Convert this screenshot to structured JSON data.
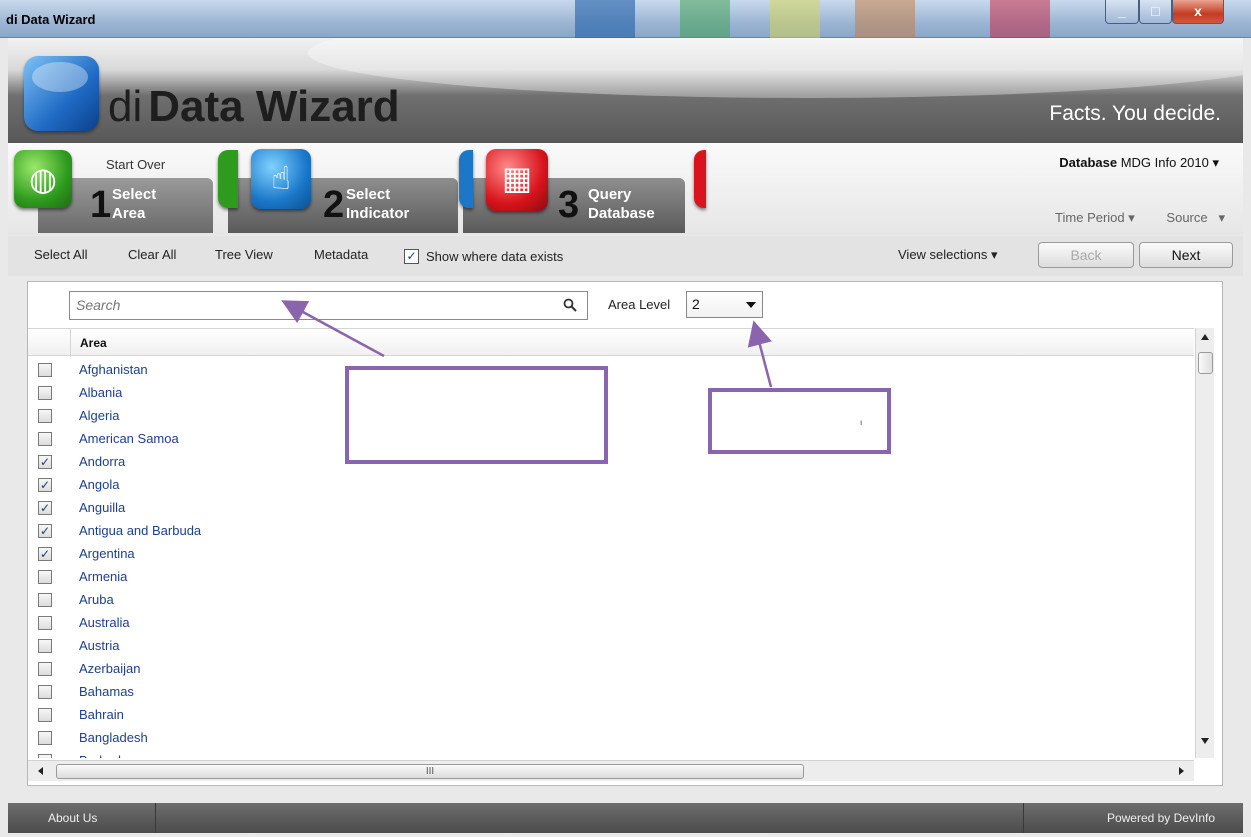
{
  "window": {
    "title": "di Data Wizard",
    "close_glyph": "x"
  },
  "banner": {
    "title_di": "di",
    "title_main": "Data Wizard",
    "tagline": "Facts. You decide."
  },
  "steps": {
    "start_over": "Start Over",
    "items": [
      {
        "number": "1",
        "line1": "Select",
        "line2": "Area"
      },
      {
        "number": "2",
        "line1": "Select",
        "line2": "Indicator"
      },
      {
        "number": "3",
        "line1": "Query",
        "line2": "Database"
      }
    ],
    "database_label": "Database",
    "database_value": "MDG Info 2010",
    "time_period": "Time Period",
    "source": "Source"
  },
  "toolbar": {
    "select_all": "Select All",
    "clear_all": "Clear All",
    "tree_view": "Tree View",
    "metadata": "Metadata",
    "show_where_data_exists": "Show where data exists",
    "show_where_checked": true,
    "view_selections": "View selections",
    "back": "Back",
    "next": "Next"
  },
  "search": {
    "placeholder": "Search",
    "area_level_label": "Area Level",
    "area_level_value": "2"
  },
  "grid": {
    "column_header": "Area",
    "rows": [
      {
        "name": "Afghanistan",
        "checked": false
      },
      {
        "name": "Albania",
        "checked": false
      },
      {
        "name": "Algeria",
        "checked": false
      },
      {
        "name": "American Samoa",
        "checked": false
      },
      {
        "name": "Andorra",
        "checked": true
      },
      {
        "name": "Angola",
        "checked": true
      },
      {
        "name": "Anguilla",
        "checked": true
      },
      {
        "name": "Antigua and Barbuda",
        "checked": true
      },
      {
        "name": "Argentina",
        "checked": true
      },
      {
        "name": "Armenia",
        "checked": false
      },
      {
        "name": "Aruba",
        "checked": false
      },
      {
        "name": "Australia",
        "checked": false
      },
      {
        "name": "Austria",
        "checked": false
      },
      {
        "name": "Azerbaijan",
        "checked": false
      },
      {
        "name": "Bahamas",
        "checked": false
      },
      {
        "name": "Bahrain",
        "checked": false
      },
      {
        "name": "Bangladesh",
        "checked": false
      },
      {
        "name": "Barbados",
        "checked": false
      }
    ],
    "hscroll_grip": "III"
  },
  "footer": {
    "about": "About Us",
    "powered_by": "Powered by DevInfo"
  },
  "annotation": {
    "box2_mark": "ı"
  },
  "colors": {
    "annotation": "#8a64ad",
    "link_text": "#1d3f8c",
    "step_green": "#2e9b1e",
    "step_blue": "#1b78c9",
    "step_red": "#d8141c"
  }
}
